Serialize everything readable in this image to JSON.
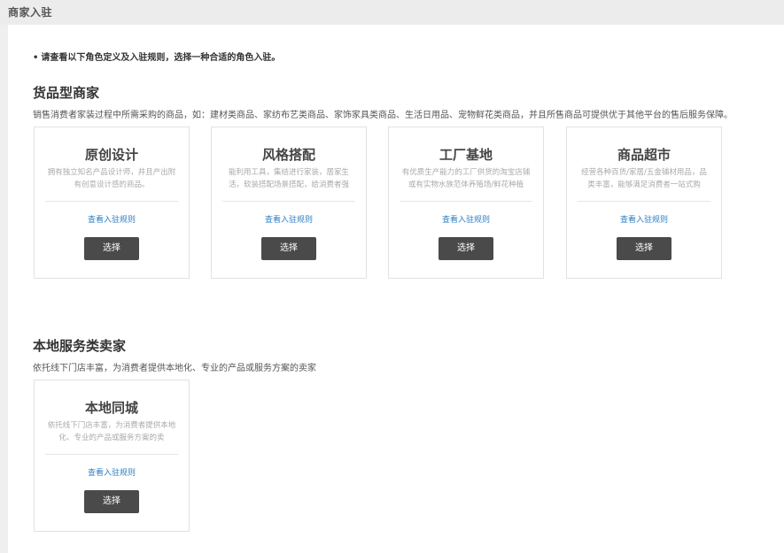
{
  "header": {
    "title": "商家入驻"
  },
  "notice": {
    "bullet": "•",
    "text": "请查看以下角色定义及入驻规则，选择一种合适的角色入驻。"
  },
  "sections": [
    {
      "title": "货品型商家",
      "description": "销售消费者家装过程中所需采购的商品，如：建材类商品、家纺布艺类商品、家饰家具类商品、生活日用品、宠物鲜花类商品，并且所售商品可提供优于其他平台的售后服务保障。",
      "cards": [
        {
          "title": "原创设计",
          "description": "拥有独立知名产品设计师，并且产出附有创意设计感的商品。",
          "link": "查看入驻规则",
          "button": "选择"
        },
        {
          "title": "风格搭配",
          "description": "能利用工具，集结进行家装，居家生活，软装搭配场景搭配，给消费者强",
          "link": "查看入驻规则",
          "button": "选择"
        },
        {
          "title": "工厂基地",
          "description": "有优质生产能力的工厂供货的淘宝店铺或有实物水族范体养殖场/鲜花种植",
          "link": "查看入驻规则",
          "button": "选择"
        },
        {
          "title": "商品超市",
          "description": "经营各种百货/家居/五金铺材用品，品类丰富，能够满足消费者一站式购",
          "link": "查看入驻规则",
          "button": "选择"
        }
      ]
    },
    {
      "title": "本地服务类卖家",
      "description": "依托线下门店丰富，为消费者提供本地化、专业的产品或服务方案的卖家",
      "cards": [
        {
          "title": "本地同城",
          "description": "依托线下门店丰富，为消费者提供本地化、专业的产品或服务方案的卖",
          "link": "查看入驻规则",
          "button": "选择"
        }
      ]
    }
  ]
}
